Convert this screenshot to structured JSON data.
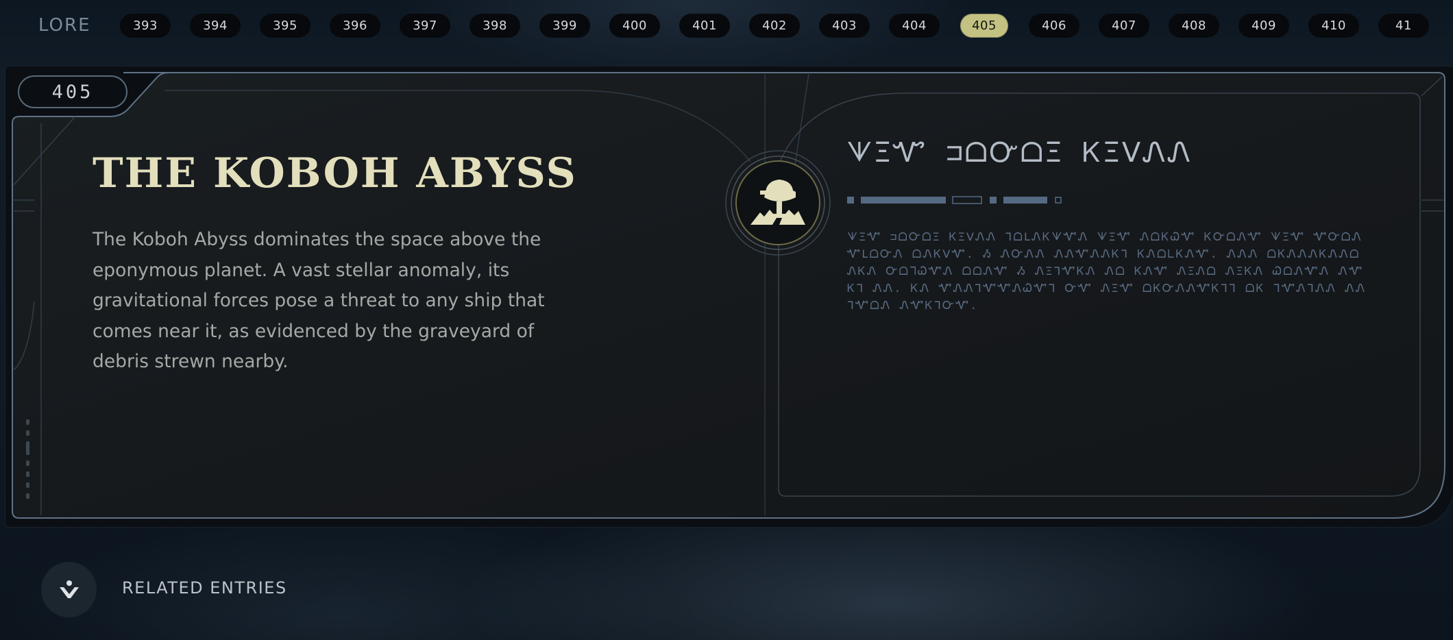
{
  "nav": {
    "section_title": "LORE",
    "pages": [
      "393",
      "394",
      "395",
      "396",
      "397",
      "398",
      "399",
      "400",
      "401",
      "402",
      "403",
      "404",
      "405",
      "406",
      "407",
      "408",
      "409",
      "410",
      "41"
    ],
    "active_page": "405"
  },
  "entry": {
    "number": "405",
    "title": "THE KOBOH ABYSS",
    "description": "The Koboh Abyss dominates the space above the eponymous planet. A vast stellar anomaly, its gravitational forces pose a threat to any ship that comes near it, as evidenced by the graveyard of debris strewn nearby.",
    "emblem_icon": "koboh-abyss-emblem-icon",
    "aurebesh_heading": "ᗐΞᏉ ⊐ᗝᏅᗝΞ ᏦΞᐯᏁᏁ",
    "aurebesh_body": "ᗐΞᏉ ⊐ᗝᏅᗝΞ ᏦΞᐯᏁᏁ ᒣᗝᒪᏁᏦᗐᏉᏁ ᗐΞᏉ ᏁᗝᏦᏇᏉ ᏦᏅᗝᏁᏉ ᗐΞᏉ ᏉᏅᗝᏁᏉᒪᗝᏅᏁ ᗝᏁᏦᐯᏉ. Ᏹ ᏁᏅᏁᏁ ᏁᏁᏉᏁᏁᏦᒣ ᏦᏁᗝᒪᏦᏁᏉ. ᏁᏁᏁ ᗝᏦᏁᏁᏁᏦᏁᏁᗝᏁᏦᏁ ᏅᗝᒣᏇᏉᏁ ᗝᗝᏁᏉ Ᏹ ᏁΞᒣᏉᏦᏁ Ꮑᗝ ᏦᏁᏉ ᏁΞᏁᗝ ᏁΞᏦᏁ ᏇᗝᏁᏉᏁ ᏁᏉᏦᒣ ᏁᏁ. ᏦᏁ ᏉᏁᏁᒣᏉᏉᏁᏇᏉᒣ ᏅᏉ ᏁΞᏉ ᗝᏦᏅᏁᏁᏉᏦᒣᒣ ᗝᏦ ᒣᏉᏁᒣᏁᏁ ᏁᏁᒣᏉᗝᏁ ᏁᏉᏦᒣᏅᏉ.",
    "decor_accent": "#c3c283"
  },
  "related": {
    "label": "RELATED ENTRIES",
    "icon": "related-entries-icon"
  }
}
